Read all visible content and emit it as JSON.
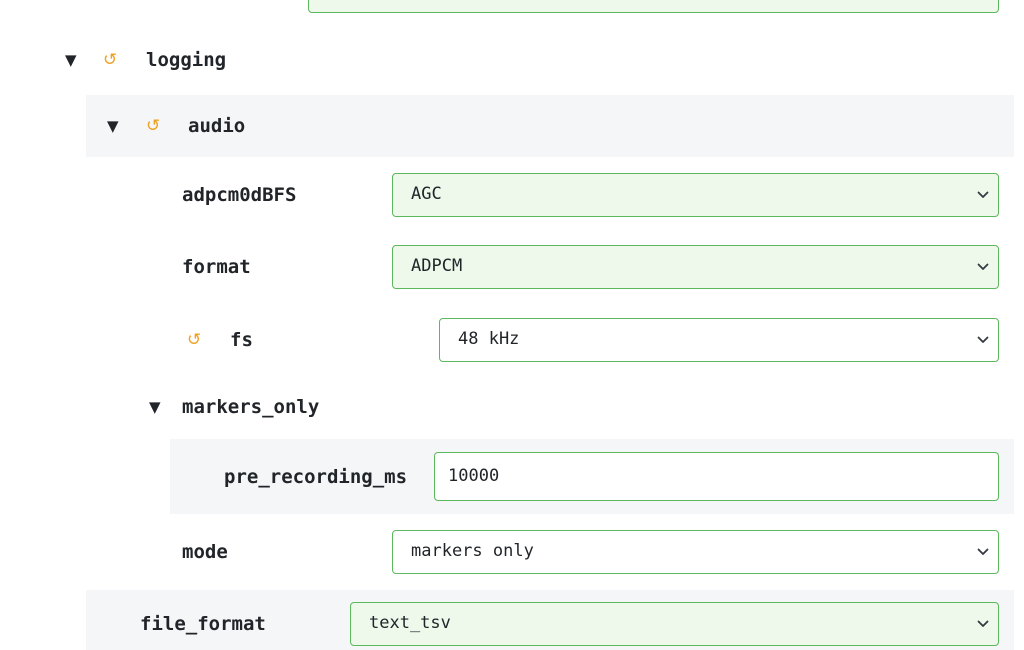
{
  "sections": {
    "logging": {
      "label": "logging",
      "expanded": true
    },
    "audio": {
      "label": "audio",
      "expanded": true
    },
    "markers_only": {
      "label": "markers_only",
      "expanded": true
    }
  },
  "fields": {
    "adpcm0dBFS": {
      "label": "adpcm0dBFS",
      "value": "AGC"
    },
    "format": {
      "label": "format",
      "value": "ADPCM"
    },
    "fs": {
      "label": "fs",
      "value": "48 kHz"
    },
    "pre_recording_ms": {
      "label": "pre_recording_ms",
      "value": "10000"
    },
    "mode": {
      "label": "mode",
      "value": "markers only"
    },
    "file_format": {
      "label": "file_format",
      "value": "text_tsv"
    }
  },
  "icons": {
    "expand_glyph": "▼",
    "reset_glyph": "↺"
  },
  "colors": {
    "reset_icon": "#f0a020",
    "field_border": "#5cb85c",
    "field_tint": "#eef9ec",
    "section_band": "#f5f6f8"
  }
}
